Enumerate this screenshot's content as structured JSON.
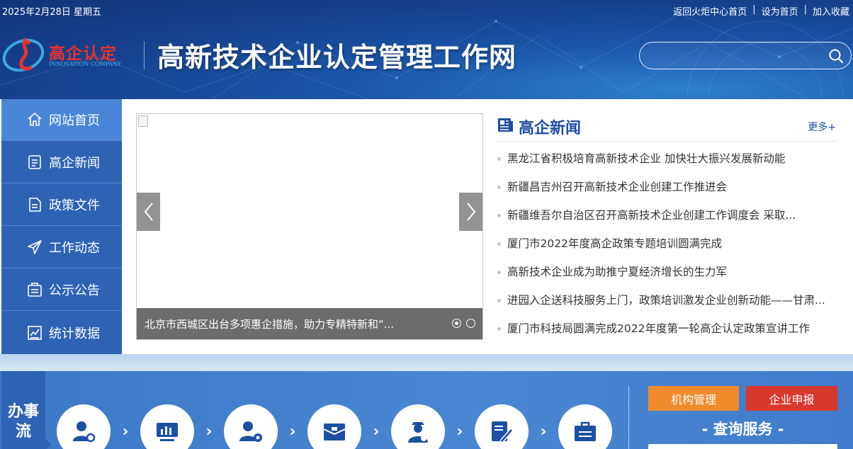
{
  "header": {
    "date": "2025年2月28日 星期五",
    "links": [
      "返回火炬中心首页",
      "设为首页",
      "加入收藏"
    ],
    "logo_text": "高企认定",
    "logo_sub": "INNOVATION COMPANY",
    "site_title": "高新技术企业认定管理工作网",
    "search": {
      "value": "",
      "icon": "search-icon"
    }
  },
  "sidebar": {
    "items": [
      {
        "label": "网站首页",
        "icon": "home-icon",
        "active": true
      },
      {
        "label": "高企新闻",
        "icon": "news-doc-icon"
      },
      {
        "label": "政策文件",
        "icon": "file-icon"
      },
      {
        "label": "工作动态",
        "icon": "paper-plane-icon"
      },
      {
        "label": "公示公告",
        "icon": "notice-icon"
      },
      {
        "label": "统计数据",
        "icon": "chart-icon"
      }
    ]
  },
  "slider": {
    "caption": "北京市西城区出台多项惠企措施，助力专精特新和“...",
    "slide_count": 2,
    "current": 1
  },
  "news": {
    "title": "高企新闻",
    "more": "更多+",
    "items": [
      "黑龙江省积极培育高新技术企业 加快壮大振兴发展新动能",
      "新疆昌吉州召开高新技术企业创建工作推进会",
      "新疆维吾尔自治区召开高新技术企业创建工作调度会 采取...",
      "厦门市2022年度高企政策专题培训圆满完成",
      "高新技术企业成为助推宁夏经济增长的生力军",
      "进园入企送科技服务上门，政策培训激发企业创新动能——甘肃...",
      "厦门市科技局圆满完成2022年度第一轮高企认定政策宣讲工作"
    ]
  },
  "bottom": {
    "tag": "办事",
    "tag_last": "流",
    "services": [
      "user-settings-icon",
      "monitor-chart-icon",
      "user-gear-icon",
      "archive-box-icon",
      "support-staff-icon",
      "edit-form-icon",
      "briefcase-icon"
    ],
    "buttons": {
      "org": "机构管理",
      "apply": "企业申报"
    },
    "query_title": "- 查询服务 -"
  },
  "colors": {
    "nav_bg": "#2e63b4",
    "nav_active": "#4a86d8",
    "accent_blue": "#1d4fa3",
    "orange": "#f08a2b",
    "red": "#d9382c"
  }
}
